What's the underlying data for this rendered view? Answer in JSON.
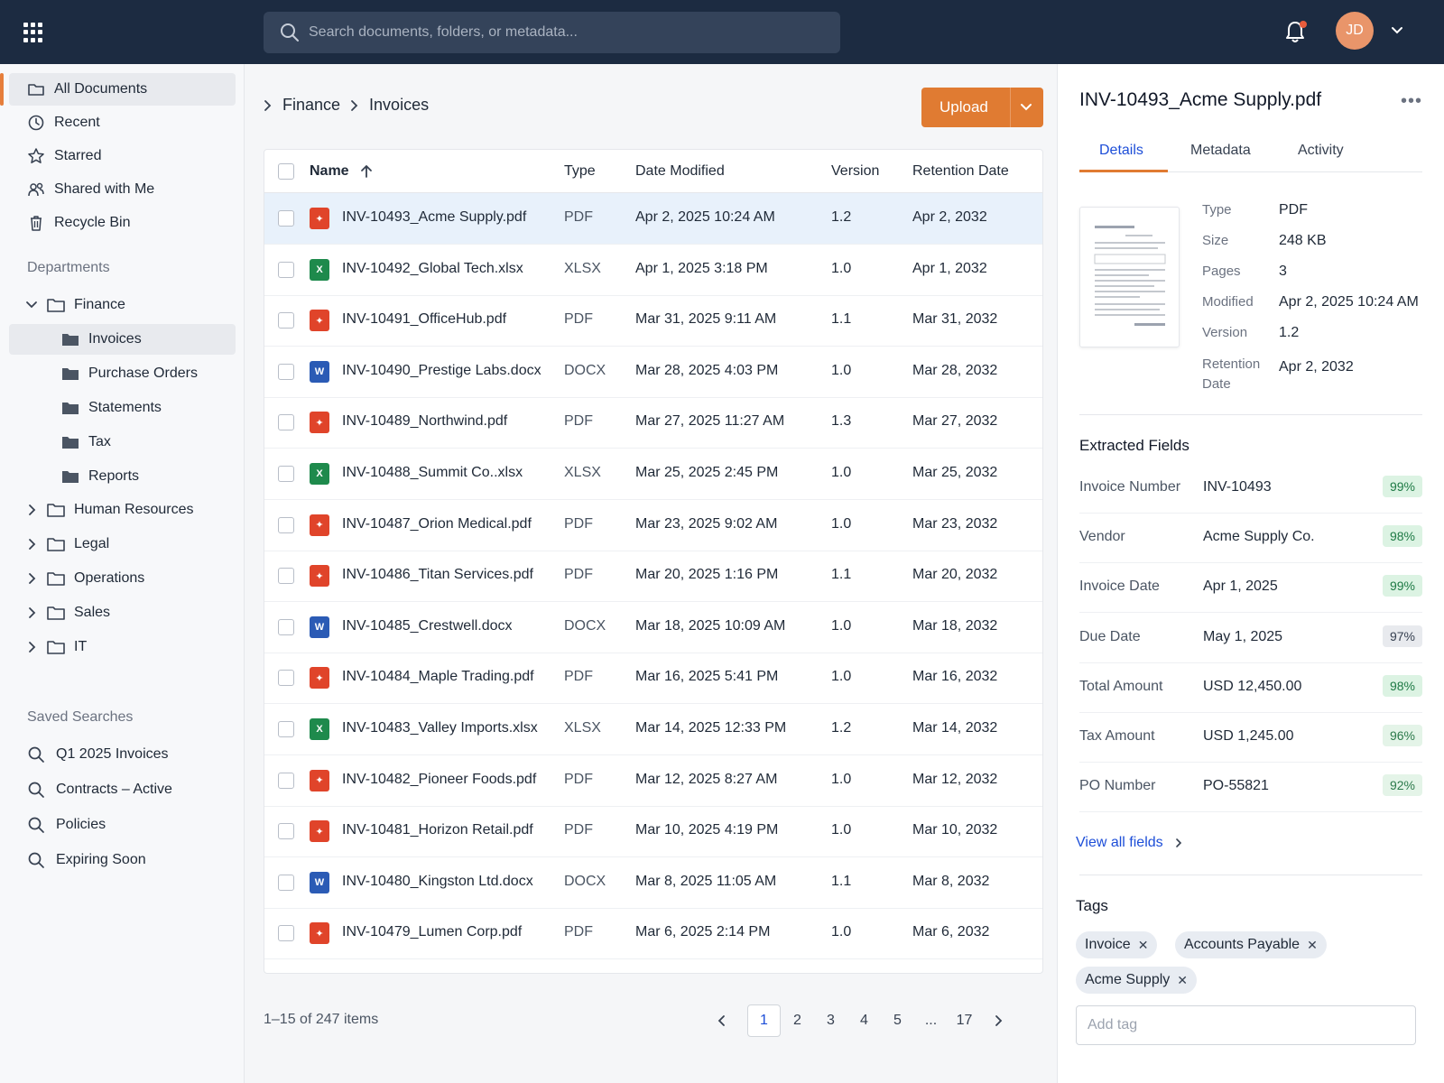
{
  "search": {
    "placeholder": "Search documents, folders, or metadata..."
  },
  "user": {
    "initials": "JD"
  },
  "colors": {
    "topbar": "#1c2b41",
    "accent": "#e07b32",
    "link": "#1d4ed8",
    "pdf": "#e0442a",
    "xlsx": "#1e8a4c",
    "docx": "#2b5bb5"
  },
  "sidebar": {
    "nav": [
      {
        "label": "All Documents",
        "icon": "folder-icon"
      },
      {
        "label": "Recent",
        "icon": "clock-icon"
      },
      {
        "label": "Starred",
        "icon": "star-icon"
      },
      {
        "label": "Shared with Me",
        "icon": "users-icon"
      },
      {
        "label": "Recycle Bin",
        "icon": "trash-icon"
      }
    ],
    "departments_title": "Departments",
    "tree": {
      "finance": "Finance",
      "finance_children": [
        "Invoices",
        "Purchase Orders",
        "Statements",
        "Tax",
        "Reports"
      ],
      "others": [
        "Human Resources",
        "Legal",
        "Operations",
        "Sales",
        "IT"
      ]
    },
    "saved_title": "Saved Searches",
    "saved": [
      "Q1 2025 Invoices",
      "Contracts – Active",
      "Policies",
      "Expiring Soon"
    ]
  },
  "breadcrumb": [
    "Finance",
    "Invoices"
  ],
  "upload_label": "Upload",
  "table": {
    "columns": {
      "name": "Name",
      "type": "Type",
      "date": "Date Modified",
      "version": "Version",
      "retention": "Retention Date"
    },
    "rows": [
      {
        "name": "INV-10493_Acme Supply.pdf",
        "type": "PDF",
        "date": "Apr 2, 2025 10:24 AM",
        "version": "1.2",
        "retention": "Apr 2, 2032"
      },
      {
        "name": "INV-10492_Global Tech.xlsx",
        "type": "XLSX",
        "date": "Apr 1, 2025 3:18 PM",
        "version": "1.0",
        "retention": "Apr 1, 2032"
      },
      {
        "name": "INV-10491_OfficeHub.pdf",
        "type": "PDF",
        "date": "Mar 31, 2025 9:11 AM",
        "version": "1.1",
        "retention": "Mar 31, 2032"
      },
      {
        "name": "INV-10490_Prestige Labs.docx",
        "type": "DOCX",
        "date": "Mar 28, 2025 4:03 PM",
        "version": "1.0",
        "retention": "Mar 28, 2032"
      },
      {
        "name": "INV-10489_Northwind.pdf",
        "type": "PDF",
        "date": "Mar 27, 2025 11:27 AM",
        "version": "1.3",
        "retention": "Mar 27, 2032"
      },
      {
        "name": "INV-10488_Summit Co..xlsx",
        "type": "XLSX",
        "date": "Mar 25, 2025 2:45 PM",
        "version": "1.0",
        "retention": "Mar 25, 2032"
      },
      {
        "name": "INV-10487_Orion Medical.pdf",
        "type": "PDF",
        "date": "Mar 23, 2025 9:02 AM",
        "version": "1.0",
        "retention": "Mar 23, 2032"
      },
      {
        "name": "INV-10486_Titan Services.pdf",
        "type": "PDF",
        "date": "Mar 20, 2025 1:16 PM",
        "version": "1.1",
        "retention": "Mar 20, 2032"
      },
      {
        "name": "INV-10485_Crestwell.docx",
        "type": "DOCX",
        "date": "Mar 18, 2025 10:09 AM",
        "version": "1.0",
        "retention": "Mar 18, 2032"
      },
      {
        "name": "INV-10484_Maple Trading.pdf",
        "type": "PDF",
        "date": "Mar 16, 2025 5:41 PM",
        "version": "1.0",
        "retention": "Mar 16, 2032"
      },
      {
        "name": "INV-10483_Valley Imports.xlsx",
        "type": "XLSX",
        "date": "Mar 14, 2025 12:33 PM",
        "version": "1.2",
        "retention": "Mar 14, 2032"
      },
      {
        "name": "INV-10482_Pioneer Foods.pdf",
        "type": "PDF",
        "date": "Mar 12, 2025 8:27 AM",
        "version": "1.0",
        "retention": "Mar 12, 2032"
      },
      {
        "name": "INV-10481_Horizon Retail.pdf",
        "type": "PDF",
        "date": "Mar 10, 2025 4:19 PM",
        "version": "1.0",
        "retention": "Mar 10, 2032"
      },
      {
        "name": "INV-10480_Kingston Ltd.docx",
        "type": "DOCX",
        "date": "Mar 8, 2025 11:05 AM",
        "version": "1.1",
        "retention": "Mar 8, 2032"
      },
      {
        "name": "INV-10479_Lumen Corp.pdf",
        "type": "PDF",
        "date": "Mar 6, 2025 2:14 PM",
        "version": "1.0",
        "retention": "Mar 6, 2032"
      }
    ]
  },
  "pagination": {
    "summary": "1–15 of 247 items",
    "pages": [
      "1",
      "2",
      "3",
      "4",
      "5",
      "...",
      "17"
    ],
    "current": "1"
  },
  "panel": {
    "title": "INV-10493_Acme Supply.pdf",
    "more": "•••",
    "tabs": [
      "Details",
      "Metadata",
      "Activity"
    ],
    "details": [
      {
        "k": "Type",
        "v": "PDF"
      },
      {
        "k": "Size",
        "v": "248 KB"
      },
      {
        "k": "Pages",
        "v": "3"
      },
      {
        "k": "Modified",
        "v": "Apr 2, 2025 10:24 AM"
      },
      {
        "k": "Version",
        "v": "1.2"
      },
      {
        "k": "Retention Date",
        "v": "Apr 2, 2032"
      }
    ],
    "extracted_title": "Extracted Fields",
    "extracted": [
      {
        "label": "Invoice Number",
        "value": "INV-10493",
        "conf": "99%"
      },
      {
        "label": "Vendor",
        "value": "Acme Supply Co.",
        "conf": "98%"
      },
      {
        "label": "Invoice Date",
        "value": "Apr 1, 2025",
        "conf": "99%"
      },
      {
        "label": "Due Date",
        "value": "May 1, 2025",
        "conf": "97%"
      },
      {
        "label": "Total Amount",
        "value": "USD 12,450.00",
        "conf": "98%"
      },
      {
        "label": "Tax Amount",
        "value": "USD 1,245.00",
        "conf": "96%"
      },
      {
        "label": "PO Number",
        "value": "PO-55821",
        "conf": "92%"
      }
    ],
    "view_all": "View all fields",
    "tags_title": "Tags",
    "tags": [
      "Invoice",
      "Accounts Payable",
      "Acme Supply"
    ],
    "add_tag_placeholder": "Add tag"
  }
}
